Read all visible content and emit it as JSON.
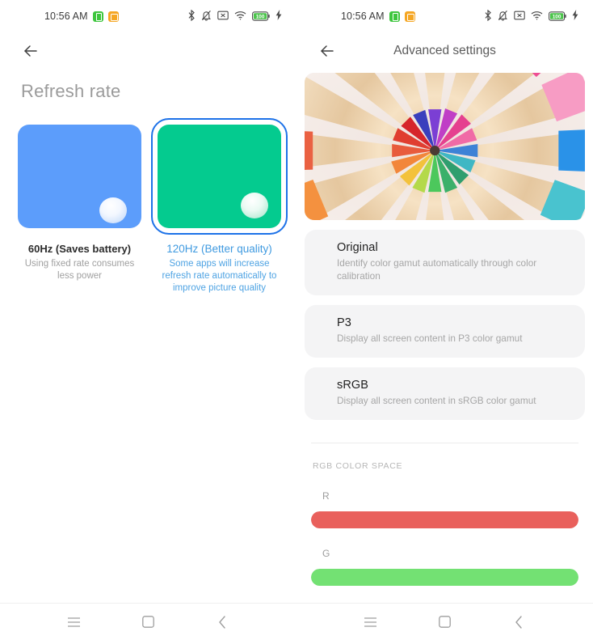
{
  "status_bar": {
    "time": "10:56 AM",
    "left_icons": [
      "app-green-icon",
      "app-orange-icon"
    ],
    "right_icons": [
      "bluetooth-icon",
      "silent-bell-icon",
      "no-sim-icon",
      "wifi-icon",
      "battery-icon",
      "charging-bolt-icon"
    ],
    "battery_level": "100"
  },
  "left_screen": {
    "back_label": "back-arrow",
    "page_title": "Refresh rate",
    "options": [
      {
        "label": "60Hz (Saves battery)",
        "description": "Using fixed rate consumes less power",
        "selected": false,
        "thumb_color": "#5c9dfb"
      },
      {
        "label": "120Hz (Better quality)",
        "description": "Some apps will increase refresh rate automatically to improve picture quality",
        "selected": true,
        "thumb_color": "#04cb8f"
      }
    ]
  },
  "right_screen": {
    "title": "Advanced settings",
    "hero_image": "colored-pencils-photo",
    "gamut_options": [
      {
        "title": "Original",
        "description": "Identify color gamut automatically through color calibration"
      },
      {
        "title": "P3",
        "description": "Display all screen content in P3 color gamut"
      },
      {
        "title": "sRGB",
        "description": "Display all screen content in sRGB color gamut"
      }
    ],
    "section_header": "RGB COLOR SPACE",
    "sliders": [
      {
        "label": "R",
        "color": "#e9605c",
        "value": 100
      },
      {
        "label": "G",
        "color": "#73e173",
        "value": 100
      }
    ]
  },
  "nav_bar": {
    "buttons": [
      "recents-menu-icon",
      "home-square-icon",
      "back-chevron-icon"
    ]
  },
  "colors": {
    "accent_blue": "#1d72e8",
    "link_blue": "#4ea3e3",
    "card_gray": "#f4f4f5"
  }
}
